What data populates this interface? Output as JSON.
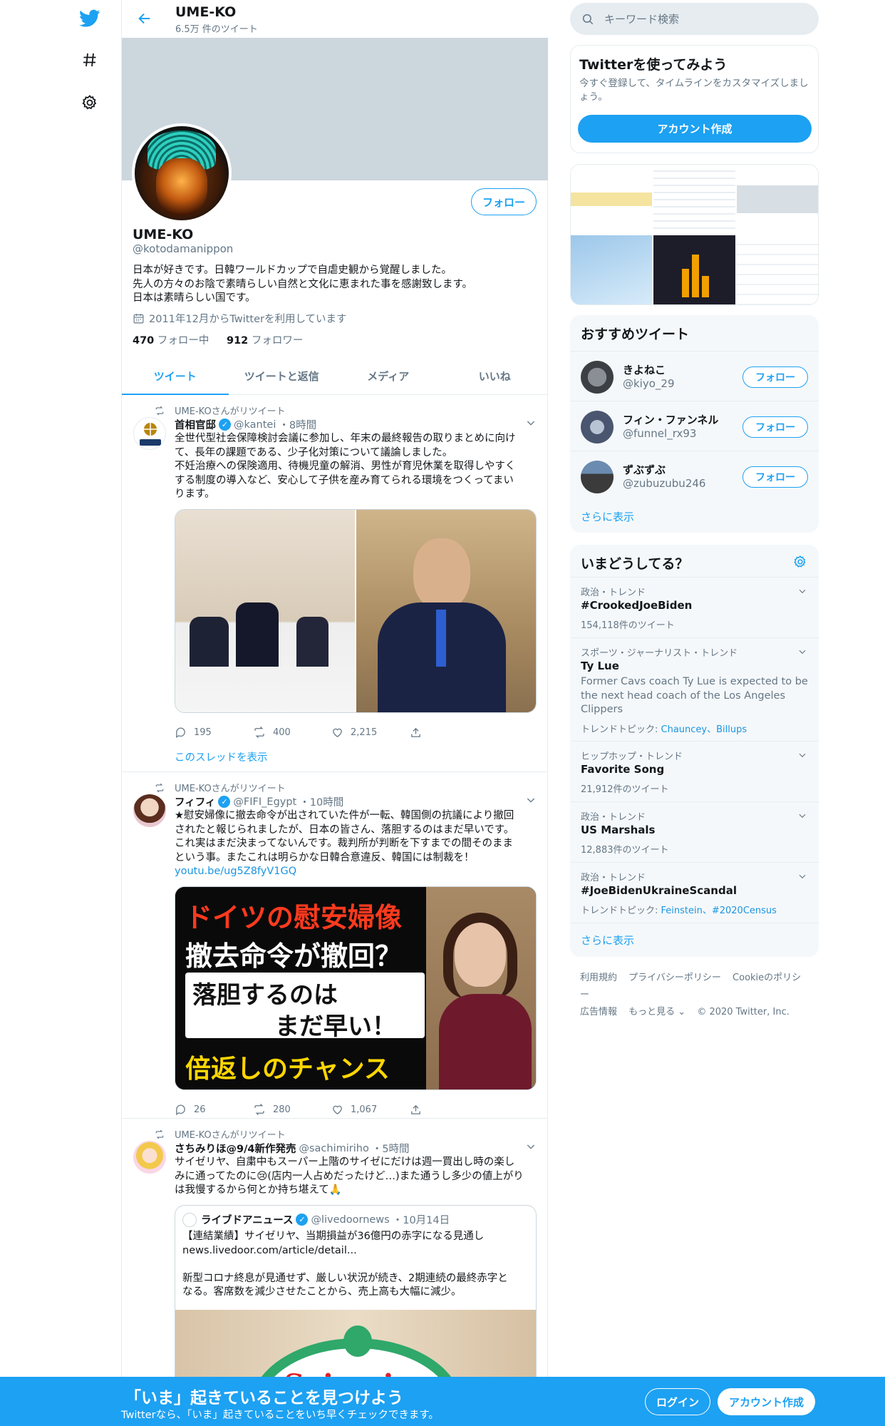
{
  "profile": {
    "name": "UME-KO",
    "tweet_count": "6.5万 件のツイート",
    "handle": "@kotodamanippon",
    "follow_label": "フォロー",
    "bio": [
      "日本が好きです。日韓ワールドカップで自虐史観から覚醒しました。",
      "先人の方々のお陰で素晴らしい自然と文化に恵まれた事を感謝致します。",
      "日本は素晴らしい国です。"
    ],
    "joined": "2011年12月からTwitterを利用しています",
    "following_count": "470",
    "following_label": "フォロー中",
    "followers_count": "912",
    "followers_label": "フォロワー"
  },
  "tabs": [
    "ツイート",
    "ツイートと返信",
    "メディア",
    "いいね"
  ],
  "tweets": [
    {
      "retweet_label": "UME-KOさんがリツイート",
      "name": "首相官邸",
      "handle": "@kantei",
      "time": "・8時間",
      "lines": [
        "全世代型社会保障検討会議に参加し、年末の最終報告の取りまとめに向け",
        "て、長年の課題である、少子化対策について議論しました。",
        "不妊治療への保険適用、待機児童の解消、男性が育児休業を取得しやすく",
        "する制度の導入など、安心して子供を産み育てられる環境をつくってまい",
        "ります。"
      ],
      "replies": "195",
      "retweets": "400",
      "likes": "2,215",
      "show_thread": "このスレッドを表示"
    },
    {
      "retweet_label": "UME-KOさんがリツイート",
      "name": "フィフィ",
      "handle": "@FIFI_Egypt",
      "time": "・10時間",
      "lines": [
        "★慰安婦像に撤去命令が出されていた件が一転、韓国側の抗議により撤回",
        "されたと報じられましたが、日本の皆さん、落胆するのはまだ早いです。",
        "これ実はまだ決まってないんです。裁判所が判断を下すまでの間そのまま",
        "という事。またこれは明らかな日韓合意違反、韓国には制裁を！"
      ],
      "link": "youtu.be/ug5Z8fyV1GQ",
      "thumb_lines": [
        "ドイツの慰安婦像",
        "撤去命令が撤回？",
        "落胆するのは",
        "まだ早い！",
        "倍返しのチャンス"
      ],
      "replies": "26",
      "retweets": "280",
      "likes": "1,067"
    },
    {
      "retweet_label": "UME-KOさんがリツイート",
      "name": "さちみりほ@9/4新作発売",
      "handle": "@sachimiriho",
      "time": "・5時間",
      "lines": [
        "サイゼリヤ、自粛中もスーパー上階のサイゼにだけは週一買出し時の楽し",
        "みに通ってたのに😢(店内一人占めだったけど…)また通うし多少の値上がり",
        "は我慢するから何とか持ち堪えて🙏"
      ],
      "quote": {
        "name": "ライブドアニュース",
        "handle": "@livedoornews",
        "time": "・10月14日",
        "lines": [
          "【連結業績】サイゼリヤ、当期損益が36億円の赤字になる見通し",
          "news.livedoor.com/article/detail...",
          "",
          "新型コロナ終息が見通せず、厳しい状況が続き、2期連続の最終赤字と",
          "なる。客席数を減少させたことから、売上高も大幅に減少。"
        ],
        "sign_text": "Saizeriya"
      }
    }
  ],
  "sidebar": {
    "search_placeholder": "キーワード検索",
    "signup_title": "Twitterを使ってみよう",
    "signup_desc": "今すぐ登録して、タイムラインをカスタマイズしましょう。",
    "signup_button": "アカウント作成",
    "rec_title": "おすすめツイート",
    "recs": [
      {
        "name": "きよねこ",
        "handle": "@kiyo_29",
        "button": "フォロー"
      },
      {
        "name": "フィン・ファンネル",
        "handle": "@funnel_rx93",
        "button": "フォロー"
      },
      {
        "name": "ずぶずぶ",
        "handle": "@zubuzubu246",
        "button": "フォロー"
      }
    ],
    "show_more": "さらに表示",
    "trends_title": "いまどうしてる？",
    "trends": [
      {
        "meta": "政治・トレンド",
        "name": "#CrookedJoeBiden",
        "sub": "154,118件のツイート"
      },
      {
        "meta": "スポーツ・ジャーナリスト・トレンド",
        "name": "Ty Lue",
        "desc": "Former Cavs coach Ty Lue is expected to be the next head coach of the Los Angeles Clippers",
        "sub_prefix": "トレンドトピック: ",
        "sub_links": "Chauncey、Billups"
      },
      {
        "meta": "ヒップホップ・トレンド",
        "name": "Favorite Song",
        "sub": "21,912件のツイート"
      },
      {
        "meta": "政治・トレンド",
        "name": "US Marshals",
        "sub": "12,883件のツイート"
      },
      {
        "meta": "政治・トレンド",
        "name": "#JoeBidenUkraineScandal",
        "sub_prefix": "トレンドトピック: ",
        "sub_links": "Feinstein、#2020Census"
      }
    ],
    "footer": [
      "利用規約",
      "プライバシーポリシー",
      "Cookieのポリシー",
      "広告情報",
      "もっと見る ⌄",
      "© 2020 Twitter, Inc."
    ]
  },
  "bottom_bar": {
    "headline": "「いま」起きていることを見つけよう",
    "sub": "Twitterなら、「いま」起きていることをいち早くチェックできます。",
    "login": "ログイン",
    "signup": "アカウント作成"
  }
}
